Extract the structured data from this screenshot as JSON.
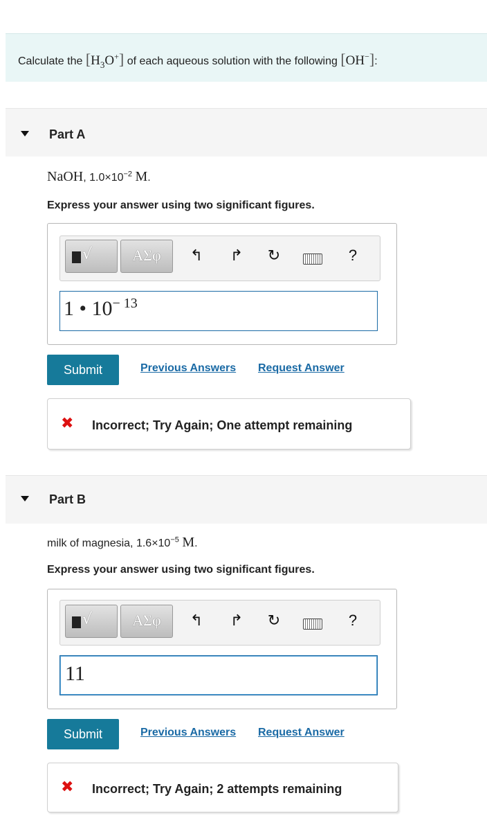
{
  "prompt": {
    "text_before": "Calculate the ",
    "text_middle": " of each aqueous solution with the following ",
    "text_after": ":",
    "h3o": {
      "base": "H",
      "sub": "3",
      "mid": "O",
      "sup": "+"
    },
    "oh": {
      "base": "OH",
      "sup": "−"
    },
    "bracket_open": "[",
    "bracket_close": "]"
  },
  "parts": [
    {
      "title": "Part A",
      "question": {
        "chem": "NaOH",
        "comma": ",",
        "value_base": " 1.0×10",
        "exp": "−2",
        "unit": "M",
        "period": "."
      },
      "instruction": "Express your answer using two significant figures.",
      "toolbar": {
        "template_icon": "√",
        "greek": "ΑΣφ",
        "undo": "↰",
        "redo": "↱",
        "reset": "↻",
        "help": "?"
      },
      "answer": {
        "main": "1 • 10",
        "exp": "− 13"
      },
      "submit_label": "Submit",
      "previous_answers": "Previous Answers",
      "request_answer": "Request Answer",
      "feedback": "Incorrect; Try Again; One attempt remaining"
    },
    {
      "title": "Part B",
      "question": {
        "chem": "milk of magnesia",
        "comma": ",",
        "value_base": " 1.6×10",
        "exp": "−5",
        "unit": "M",
        "period": "."
      },
      "instruction": "Express your answer using two significant figures.",
      "toolbar": {
        "template_icon": "√",
        "greek": "ΑΣφ",
        "undo": "↰",
        "redo": "↱",
        "reset": "↻",
        "help": "?"
      },
      "answer": {
        "main": "11",
        "exp": ""
      },
      "submit_label": "Submit",
      "previous_answers": "Previous Answers",
      "request_answer": "Request Answer",
      "feedback": "Incorrect; Try Again; 2 attempts remaining"
    }
  ],
  "colors": {
    "submit": "#167a9a",
    "link": "#1a6aa5",
    "error": "#dd1111",
    "prompt_bg": "#e9f6f6"
  },
  "icons": {
    "caret": "caret-down-icon",
    "error": "x-mark-icon",
    "keyboard": "keyboard-icon"
  }
}
